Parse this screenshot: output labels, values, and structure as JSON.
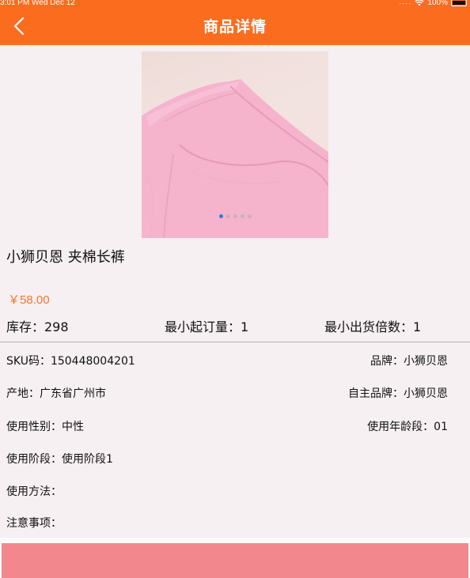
{
  "status_bar": {
    "time_date": "3:01 PM  Wed Dec 12",
    "battery": "100%"
  },
  "nav": {
    "title": "商品详情",
    "back_icon": "chevron-left-icon"
  },
  "carousel": {
    "active_index": 0,
    "count": 5
  },
  "product": {
    "name": "小狮贝恩 夹棉长裤",
    "price": "￥58.00"
  },
  "stats": {
    "stock": "库存：298",
    "min_order": "最小起订量：1",
    "min_multiple": "最小出货倍数：1"
  },
  "attributes": {
    "sku": "SKU码：150448004201",
    "brand": "品牌：小狮贝恩",
    "origin": "产地：广东省广州市",
    "own_brand": "自主品牌：小狮贝恩",
    "gender": "使用性别：中性",
    "age_range": "使用年龄段：01",
    "stage": "使用阶段：使用阶段1",
    "usage": "使用方法：",
    "caution": "注意事项："
  },
  "colors": {
    "nav_bg": "#fb6c1f",
    "price": "#f4742b",
    "buy_bar": "#f2888d",
    "page_bg": "#f6f0f2"
  }
}
